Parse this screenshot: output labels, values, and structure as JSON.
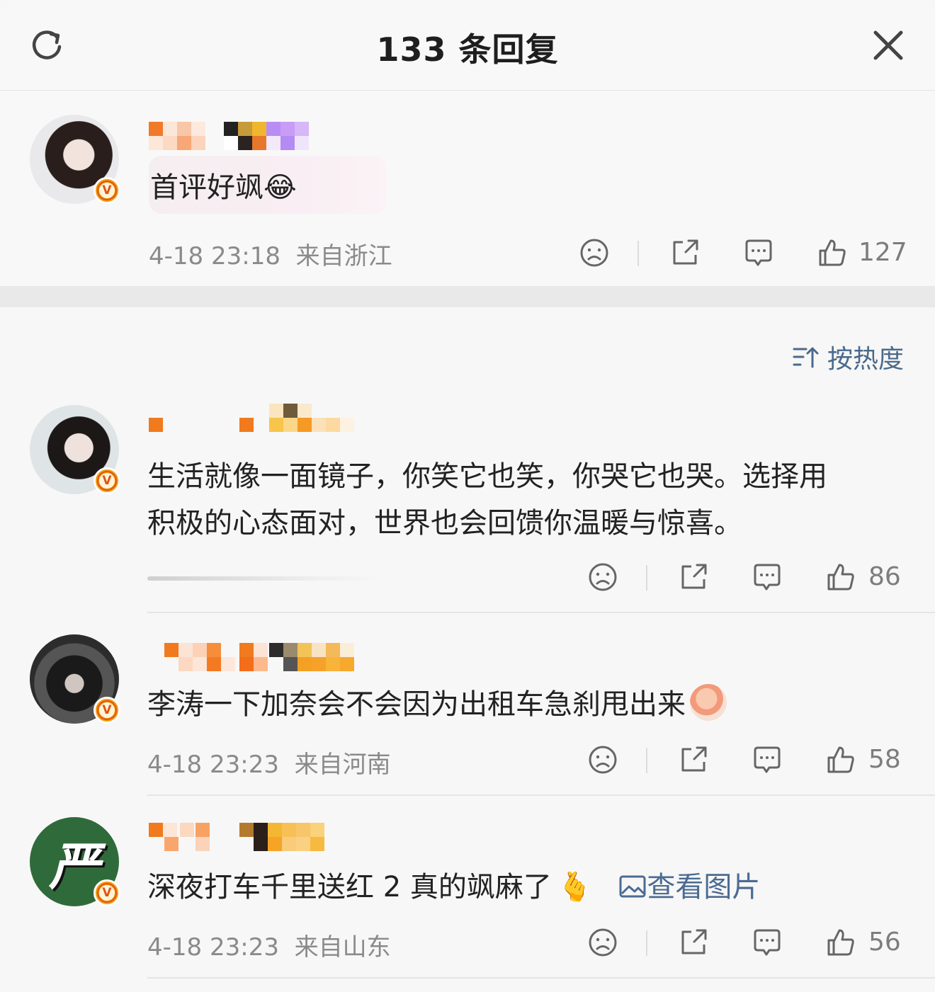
{
  "header": {
    "title": "133 条回复",
    "refresh_icon": "refresh-icon",
    "close_icon": "close-icon"
  },
  "main_comment": {
    "text": "首评好飒",
    "emoji": "😂",
    "time": "4-18 23:18",
    "location": "来自浙江",
    "likes": "127"
  },
  "sort": {
    "label": "按热度",
    "icon": "sort-icon"
  },
  "replies": [
    {
      "text_line1": "生活就像一面镜子，你笑它也笑，你哭它也哭。选择用",
      "text_line2": "积极的心态面对，世界也会回馈你温暖与惊喜。",
      "likes": "86"
    },
    {
      "text": "李涛一下加奈会不会因为出租车急刹甩出来",
      "time": "4-18 23:23",
      "location": "来自河南",
      "likes": "58"
    },
    {
      "text": "深夜打车千里送红 2 真的飒麻了",
      "emoji": "🫰",
      "view_pic": "查看图片",
      "avatar_char": "严",
      "time": "4-18 23:23",
      "location": "来自山东",
      "likes": "56"
    }
  ],
  "badge_letter": "V",
  "colors": {
    "accent": "#f39c12",
    "link": "#4b6b92",
    "meta": "#8a8a8a"
  }
}
